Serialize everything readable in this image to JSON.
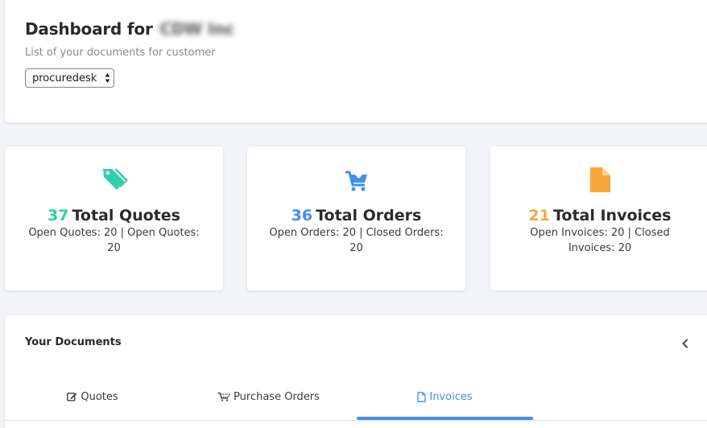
{
  "header": {
    "title_prefix": "Dashboard for",
    "customer_name": "CDW Inc",
    "subtitle": "List of your documents for customer",
    "customer_select": {
      "selected": "procuredesk"
    }
  },
  "stats": [
    {
      "key": "quotes",
      "count": "37",
      "label": "Total Quotes",
      "detail": "Open Quotes: 20 | Open Quotes: 20",
      "color": "#2fd0a8",
      "icon": "tags-icon"
    },
    {
      "key": "orders",
      "count": "36",
      "label": "Total Orders",
      "detail": "Open Orders: 20 | Closed Orders: 20",
      "color": "#3f8ef5",
      "icon": "cart-download-icon"
    },
    {
      "key": "invoices",
      "count": "21",
      "label": "Total Invoices",
      "detail": "Open Invoices: 20 | Closed Invoices: 20",
      "color": "#f6a93b",
      "icon": "file-icon"
    }
  ],
  "documents": {
    "title": "Your Documents",
    "collapse_icon": "chevron-left-icon",
    "tabs": [
      {
        "label": "Quotes",
        "icon": "edit-icon",
        "active": false
      },
      {
        "label": "Purchase Orders",
        "icon": "cart-icon",
        "active": false
      },
      {
        "label": "Invoices",
        "icon": "file-outline-icon",
        "active": true
      }
    ],
    "active_color": "#3f8ef5"
  }
}
